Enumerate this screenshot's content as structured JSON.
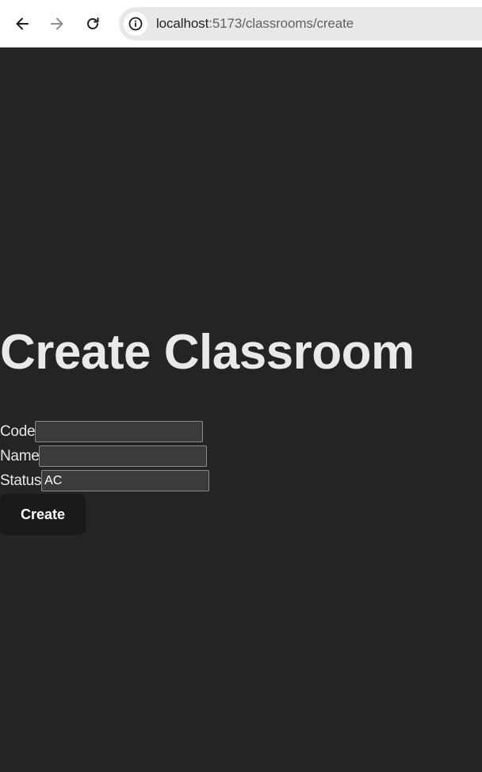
{
  "browser": {
    "url_host": "localhost",
    "url_path": ":5173/classrooms/create",
    "back_icon": "arrow-left-icon",
    "forward_icon": "arrow-right-icon",
    "reload_icon": "reload-icon",
    "site_info_icon": "info-icon"
  },
  "page": {
    "title": "Create Classroom",
    "form": {
      "code_label": "Code",
      "code_value": "",
      "name_label": "Name",
      "name_value": "",
      "status_label": "Status",
      "status_value": "AC",
      "submit_label": "Create"
    }
  },
  "colors": {
    "background": "#242424",
    "button": "#1a1a1a",
    "input": "#3b3b3b"
  }
}
